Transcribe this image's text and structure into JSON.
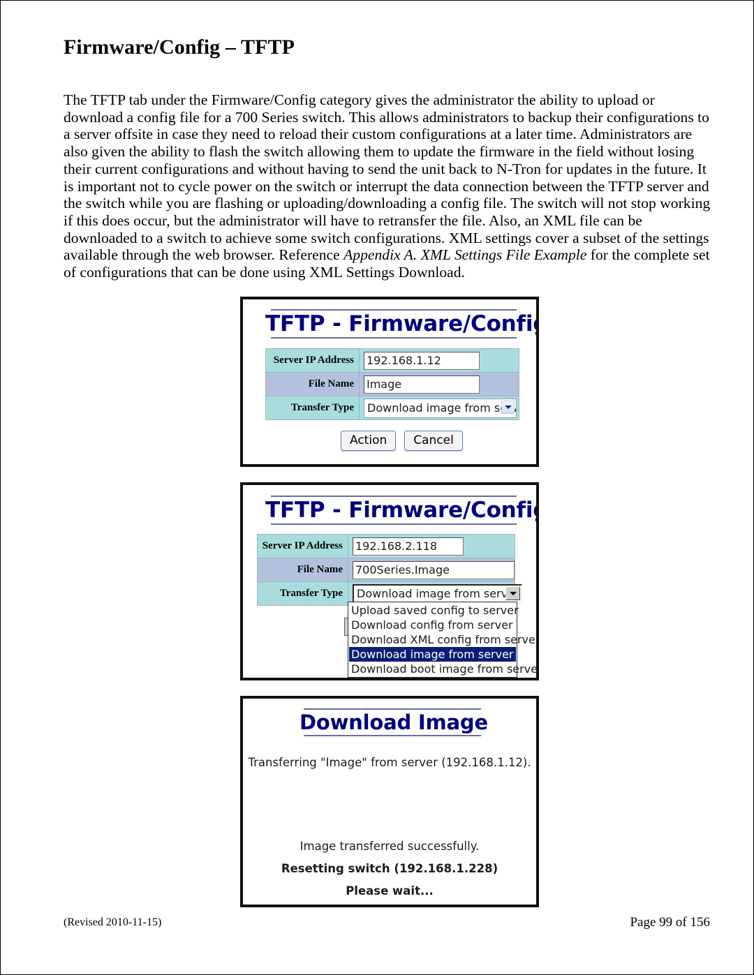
{
  "document": {
    "heading": "Firmware/Config – TFTP",
    "paragraph_part1": "The TFTP tab under the Firmware/Config category gives the administrator the ability to upload or download a config file for a 700 Series switch.  This allows administrators to backup their configurations to a server offsite in case they need to reload their custom configurations at a later time.  Administrators are also given the ability to flash the switch allowing them to update the firmware in the field without losing their current configurations and without having to send the unit back to N-Tron for updates in the future.  It is important not to cycle power on the switch or interrupt the data connection between the TFTP server and the switch while you are flashing or uploading/downloading a config file.  The switch will not stop working if this does occur, but the administrator will have to retransfer the file. Also, an XML file  can be downloaded to a switch to achieve some switch configurations. XML settings cover a subset of the settings available through the web browser.  Reference ",
    "paragraph_italic": "Appendix A. XML Settings File Example",
    "paragraph_part2": " for the complete set of configurations that can be done using XML Settings Download.",
    "footer_left": "(Revised 2010-11-15)",
    "footer_right": "Page 99 of 156"
  },
  "colors": {
    "heading_navy": "#000080",
    "row_cyan": "#a9dddd",
    "row_lavender": "#b2c2de",
    "selected_option_bg": "#0a1f73"
  },
  "panel1": {
    "title": "TFTP - Firmware/Config",
    "labels": {
      "server_ip": "Server IP Address",
      "file_name": "File Name",
      "transfer_type": "Transfer Type"
    },
    "values": {
      "server_ip": "192.168.1.12",
      "file_name": "Image",
      "transfer_type": "Download image from server"
    },
    "buttons": {
      "action": "Action",
      "cancel": "Cancel"
    }
  },
  "panel2": {
    "title": "TFTP - Firmware/Config",
    "labels": {
      "server_ip": "Server IP Address",
      "file_name": "File Name",
      "transfer_type": "Transfer Type"
    },
    "values": {
      "server_ip": "192.168.2.118",
      "file_name": "700Series.Image",
      "transfer_type": "Download image from server"
    },
    "transfer_type_options": [
      "Upload saved config to server",
      "Download config from server",
      "Download XML config from server",
      "Download image from server",
      "Download boot image from server"
    ],
    "selected_option_index": 3
  },
  "panel3": {
    "title": "Download Image",
    "lines": [
      "Transferring \"Image\" from server (192.168.1.12).",
      "Image transferred successfully.",
      "Resetting switch (192.168.1.228)",
      "Please wait..."
    ]
  }
}
